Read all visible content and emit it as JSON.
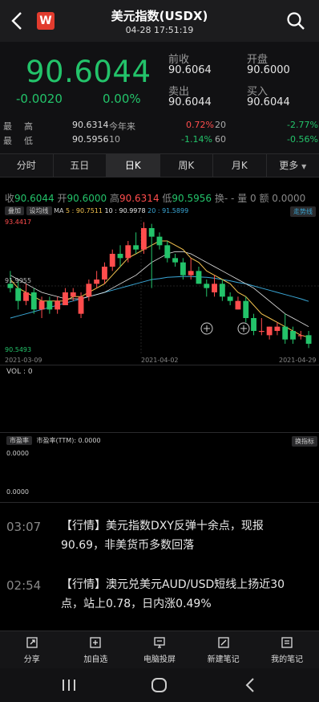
{
  "header": {
    "title": "美元指数(USDX)",
    "subtitle": "04-28 17:51:19",
    "logo": "W"
  },
  "quote": {
    "price": "90.6044",
    "change": "-0.0020",
    "change_pct": "0.00%",
    "prev_close_label": "前收",
    "prev_close": "90.6064",
    "open_label": "开盘",
    "open": "90.6000",
    "ask_label": "卖出",
    "ask": "90.6044",
    "bid_label": "买入",
    "bid": "90.6044"
  },
  "stats": [
    {
      "l1": "最",
      "l2": "高",
      "v": "90.6314",
      "p1": "今年来",
      "p1v": "0.72%",
      "p2": "20",
      "p2v": "-2.77%"
    },
    {
      "l1": "最",
      "l2": "低",
      "v": "90.5956",
      "p1": "10",
      "p1v": "-1.14%",
      "p2": "60",
      "p2v": "-0.56%"
    }
  ],
  "tabs": [
    "分时",
    "五日",
    "日K",
    "周K",
    "月K",
    "更多"
  ],
  "active_tab": "日K",
  "ohlc": {
    "close_label": "收",
    "close": "90.6044",
    "open_label": "开",
    "open": "90.6000",
    "high_label": "高",
    "high": "90.6314",
    "low_label": "低",
    "low": "90.5956",
    "turnover": "换- -",
    "volume": "量 0",
    "amount": "额 0.0000"
  },
  "indicators": {
    "overlay_btn": "叠加",
    "ma_toggle": "设均线",
    "ma_label": "MA",
    "ma5_label": "5 : 90.7511",
    "ma10_label": "10 : 90.9978",
    "ma20_label": "20 : 91.5899",
    "trend_btn": "走势线"
  },
  "chart_data": {
    "type": "candlestick",
    "y_high_label": "93.4417",
    "y_mid_label": "91.9955",
    "y_low_label": "90.5493",
    "x_labels": [
      "2021-03-09",
      "2021-04-02",
      "2021-04-29"
    ],
    "candles": [
      {
        "o": 92.0,
        "h": 92.3,
        "l": 91.8,
        "c": 91.9
      },
      {
        "o": 91.9,
        "h": 92.1,
        "l": 91.4,
        "c": 91.6
      },
      {
        "o": 91.6,
        "h": 92.0,
        "l": 91.5,
        "c": 91.8
      },
      {
        "o": 91.8,
        "h": 91.9,
        "l": 91.3,
        "c": 91.4
      },
      {
        "o": 91.4,
        "h": 91.7,
        "l": 91.2,
        "c": 91.6
      },
      {
        "o": 91.6,
        "h": 91.7,
        "l": 91.3,
        "c": 91.4
      },
      {
        "o": 91.4,
        "h": 91.7,
        "l": 91.3,
        "c": 91.6
      },
      {
        "o": 91.5,
        "h": 91.9,
        "l": 91.5,
        "c": 91.8
      },
      {
        "o": 91.7,
        "h": 91.9,
        "l": 91.6,
        "c": 91.8
      },
      {
        "o": 91.3,
        "h": 91.8,
        "l": 91.2,
        "c": 91.7
      },
      {
        "o": 91.7,
        "h": 92.1,
        "l": 91.6,
        "c": 92.0
      },
      {
        "o": 92.0,
        "h": 92.3,
        "l": 91.9,
        "c": 92.1
      },
      {
        "o": 92.1,
        "h": 92.5,
        "l": 92.0,
        "c": 92.4
      },
      {
        "o": 92.4,
        "h": 92.8,
        "l": 92.3,
        "c": 92.7
      },
      {
        "o": 92.7,
        "h": 92.9,
        "l": 92.4,
        "c": 92.6
      },
      {
        "o": 92.6,
        "h": 93.0,
        "l": 92.5,
        "c": 92.9
      },
      {
        "o": 92.9,
        "h": 93.2,
        "l": 92.7,
        "c": 92.8
      },
      {
        "o": 92.8,
        "h": 93.44,
        "l": 92.7,
        "c": 93.3
      },
      {
        "o": 93.3,
        "h": 93.4,
        "l": 91.9,
        "c": 93.1
      },
      {
        "o": 93.1,
        "h": 93.2,
        "l": 92.8,
        "c": 92.9
      },
      {
        "o": 92.9,
        "h": 93.0,
        "l": 92.5,
        "c": 92.6
      },
      {
        "o": 92.6,
        "h": 92.7,
        "l": 92.4,
        "c": 92.5
      },
      {
        "o": 92.5,
        "h": 92.6,
        "l": 92.1,
        "c": 92.2
      },
      {
        "o": 92.2,
        "h": 92.6,
        "l": 92.1,
        "c": 92.3
      },
      {
        "o": 92.3,
        "h": 92.4,
        "l": 92.0,
        "c": 92.0
      },
      {
        "o": 92.0,
        "h": 92.1,
        "l": 91.7,
        "c": 91.9
      },
      {
        "o": 91.8,
        "h": 92.2,
        "l": 91.7,
        "c": 92.0
      },
      {
        "o": 92.0,
        "h": 92.1,
        "l": 91.6,
        "c": 91.7
      },
      {
        "o": 91.7,
        "h": 91.8,
        "l": 91.5,
        "c": 91.6
      },
      {
        "o": 91.4,
        "h": 91.7,
        "l": 91.4,
        "c": 91.6
      },
      {
        "o": 91.6,
        "h": 91.7,
        "l": 91.1,
        "c": 91.2
      },
      {
        "o": 91.2,
        "h": 91.3,
        "l": 90.8,
        "c": 90.9
      },
      {
        "o": 90.9,
        "h": 91.2,
        "l": 90.8,
        "c": 90.9
      },
      {
        "o": 90.8,
        "h": 91.0,
        "l": 90.7,
        "c": 91.0
      },
      {
        "o": 90.9,
        "h": 91.1,
        "l": 90.8,
        "c": 91.0
      },
      {
        "o": 91.0,
        "h": 91.3,
        "l": 90.6,
        "c": 90.7
      },
      {
        "o": 90.9,
        "h": 91.0,
        "l": 90.6,
        "c": 90.7
      },
      {
        "o": 90.8,
        "h": 90.9,
        "l": 90.7,
        "c": 90.8
      },
      {
        "o": 90.8,
        "h": 90.9,
        "l": 90.5,
        "c": 90.6
      }
    ],
    "ma5": [
      92.1,
      91.9,
      91.8,
      91.7,
      91.6,
      91.6,
      91.6,
      91.6,
      91.7,
      91.7,
      91.8,
      91.9,
      92.0,
      92.2,
      92.4,
      92.6,
      92.7,
      92.8,
      92.9,
      93.0,
      93.0,
      92.9,
      92.8,
      92.6,
      92.5,
      92.3,
      92.2,
      92.1,
      92.0,
      91.8,
      91.7,
      91.5,
      91.3,
      91.2,
      91.1,
      91.0,
      90.9,
      90.8,
      90.75
    ],
    "ma10": [
      92.2,
      92.1,
      92.0,
      91.9,
      91.8,
      91.75,
      91.7,
      91.65,
      91.65,
      91.65,
      91.7,
      91.75,
      91.8,
      91.9,
      92.0,
      92.1,
      92.2,
      92.35,
      92.5,
      92.6,
      92.7,
      92.75,
      92.75,
      92.7,
      92.6,
      92.5,
      92.4,
      92.3,
      92.2,
      92.1,
      92.0,
      91.9,
      91.75,
      91.6,
      91.45,
      91.3,
      91.2,
      91.1,
      91.0
    ],
    "ma20": [
      91.2,
      91.25,
      91.3,
      91.35,
      91.4,
      91.45,
      91.5,
      91.55,
      91.6,
      91.65,
      91.7,
      91.75,
      91.8,
      91.85,
      91.9,
      91.95,
      92.0,
      92.05,
      92.1,
      92.12,
      92.15,
      92.16,
      92.17,
      92.17,
      92.16,
      92.15,
      92.13,
      92.1,
      92.07,
      92.03,
      92.0,
      91.95,
      91.9,
      91.85,
      91.8,
      91.75,
      91.7,
      91.65,
      91.59
    ]
  },
  "volume": {
    "label": "VOL : 0"
  },
  "pe": {
    "label": "市盈率",
    "ttm": "市盈率(TTM): 0.0000",
    "switch_btn": "换指标",
    "top_val": "0.0000",
    "bottom_val": "0.0000"
  },
  "news": [
    {
      "time": "03:07",
      "text": "【行情】美元指数DXY反弹十余点，现报90.69，非美货币多数回落"
    },
    {
      "time": "02:54",
      "text": "【行情】澳元兑美元AUD/USD短线上扬近30点，站上0.78，日内涨0.49%"
    }
  ],
  "bottom_bar": [
    {
      "label": "分享",
      "icon": "share-icon"
    },
    {
      "label": "加自选",
      "icon": "add-watchlist-icon"
    },
    {
      "label": "电脑投屏",
      "icon": "cast-screen-icon"
    },
    {
      "label": "新建笔记",
      "icon": "new-note-icon"
    },
    {
      "label": "我的笔记",
      "icon": "my-notes-icon"
    }
  ],
  "colors": {
    "up": "#ff4d4d",
    "down": "#23c36a",
    "ma5": "#f2c14e",
    "ma10": "#e8e8e8",
    "ma20": "#3aa7d6"
  }
}
